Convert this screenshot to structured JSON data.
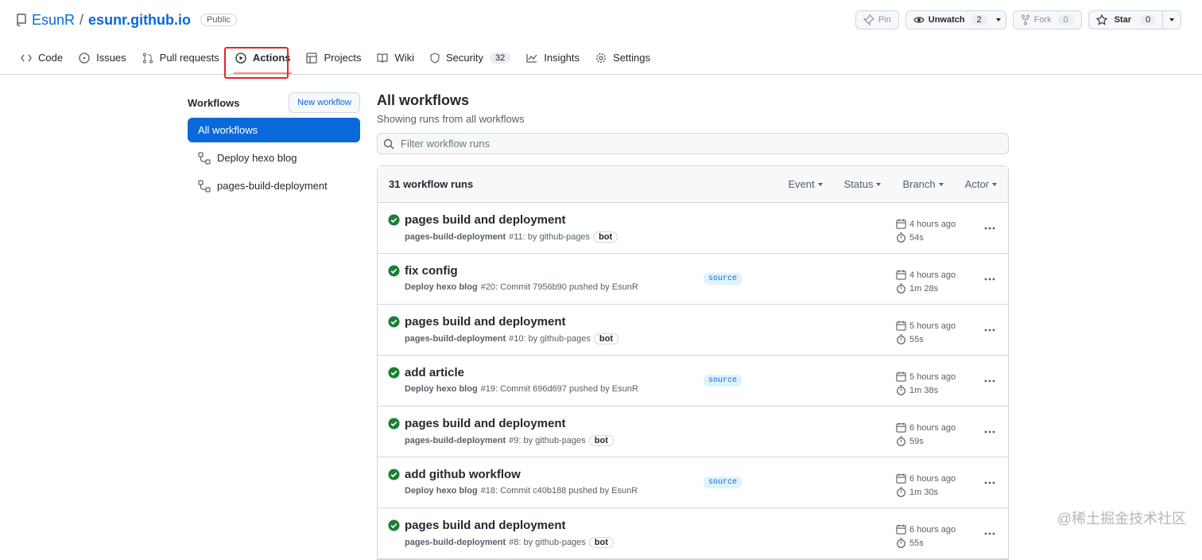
{
  "repo": {
    "owner": "EsunR",
    "separator": "/",
    "name": "esunr.github.io",
    "visibility": "Public",
    "pin_label": "Pin",
    "watch_label": "Unwatch",
    "watch_count": "2",
    "fork_label": "Fork",
    "fork_count": "0",
    "star_label": "Star",
    "star_count": "0"
  },
  "tabs": [
    {
      "label": "Code",
      "icon": "code-icon"
    },
    {
      "label": "Issues",
      "icon": "issue-icon"
    },
    {
      "label": "Pull requests",
      "icon": "pull-request-icon"
    },
    {
      "label": "Actions",
      "icon": "play-icon",
      "active": true
    },
    {
      "label": "Projects",
      "icon": "table-icon"
    },
    {
      "label": "Wiki",
      "icon": "book-icon"
    },
    {
      "label": "Security",
      "icon": "shield-icon",
      "counter": "32"
    },
    {
      "label": "Insights",
      "icon": "graph-icon"
    },
    {
      "label": "Settings",
      "icon": "gear-icon"
    }
  ],
  "sidebar": {
    "title": "Workflows",
    "new_workflow": "New workflow",
    "items": [
      {
        "label": "All workflows"
      },
      {
        "label": "Deploy hexo blog"
      },
      {
        "label": "pages-build-deployment"
      }
    ]
  },
  "main": {
    "title": "All workflows",
    "subtitle": "Showing runs from all workflows",
    "filter_placeholder": "Filter workflow runs",
    "runs_count": "31 workflow runs",
    "filters": [
      "Event",
      "Status",
      "Branch",
      "Actor"
    ]
  },
  "runs": [
    {
      "title": "pages build and deployment",
      "workflow": "pages-build-deployment",
      "detail": "#11: by github-pages",
      "bot": "bot",
      "branch": "",
      "time": "4 hours ago",
      "duration": "54s"
    },
    {
      "title": "fix config",
      "workflow": "Deploy hexo blog",
      "detail": "#20: Commit 7956b90 pushed by EsunR",
      "bot": "",
      "branch": "source",
      "time": "4 hours ago",
      "duration": "1m 28s"
    },
    {
      "title": "pages build and deployment",
      "workflow": "pages-build-deployment",
      "detail": "#10: by github-pages",
      "bot": "bot",
      "branch": "",
      "time": "5 hours ago",
      "duration": "55s"
    },
    {
      "title": "add article",
      "workflow": "Deploy hexo blog",
      "detail": "#19: Commit 696d697 pushed by EsunR",
      "bot": "",
      "branch": "source",
      "time": "5 hours ago",
      "duration": "1m 38s"
    },
    {
      "title": "pages build and deployment",
      "workflow": "pages-build-deployment",
      "detail": "#9: by github-pages",
      "bot": "bot",
      "branch": "",
      "time": "6 hours ago",
      "duration": "59s"
    },
    {
      "title": "add github workflow",
      "workflow": "Deploy hexo blog",
      "detail": "#18: Commit c40b188 pushed by EsunR",
      "bot": "",
      "branch": "source",
      "time": "6 hours ago",
      "duration": "1m 30s"
    },
    {
      "title": "pages build and deployment",
      "workflow": "pages-build-deployment",
      "detail": "#8: by github-pages",
      "bot": "bot",
      "branch": "",
      "time": "6 hours ago",
      "duration": "55s"
    }
  ],
  "watermark": "@稀土掘金技术社区",
  "colors": {
    "accent": "#0969da",
    "success": "#1a7f37",
    "highlight": "#e5252a",
    "tab_underline": "#fd8c73"
  }
}
